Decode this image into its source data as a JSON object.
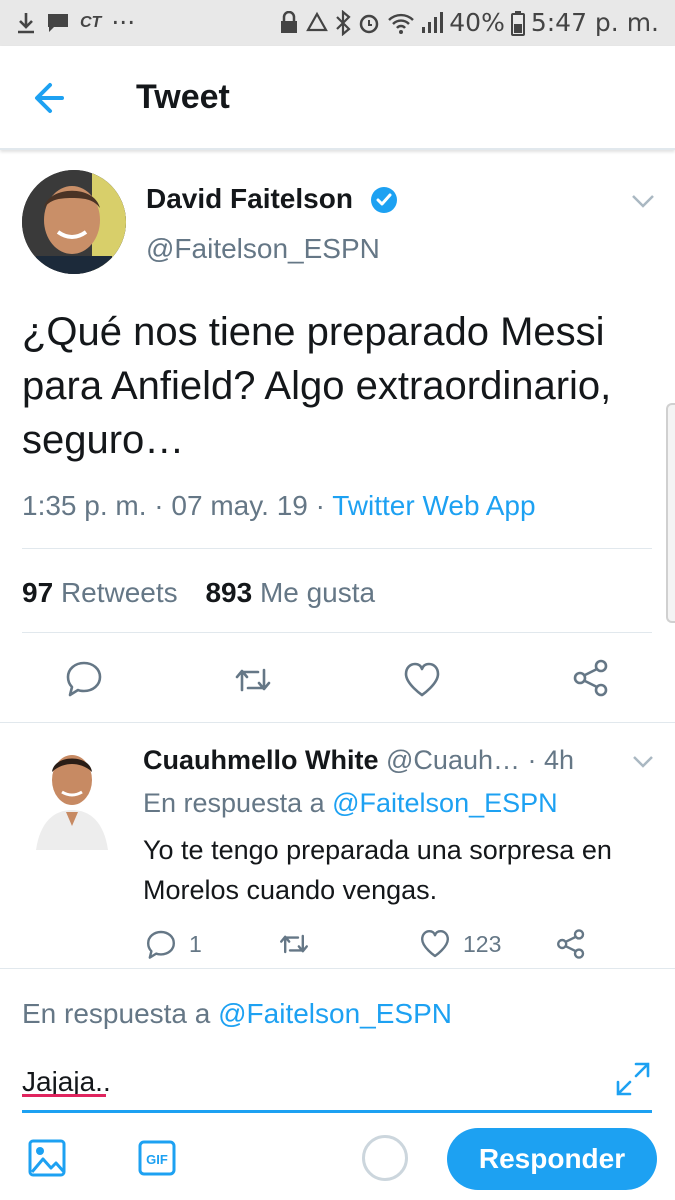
{
  "status_bar": {
    "carrier": "CT",
    "dots": "···",
    "battery": "40%",
    "time": "5:47 p. m."
  },
  "header": {
    "title": "Tweet"
  },
  "tweet": {
    "author_name": "David Faitelson",
    "author_handle": "@Faitelson_ESPN",
    "text": "¿Qué nos tiene preparado Messi para Anfield? Algo extraordinario, seguro…",
    "timestamp": "1:35 p. m. · 07 may. 19 · ",
    "source": "Twitter Web App",
    "retweets_count": "97",
    "retweets_label": "Retweets",
    "likes_count": "893",
    "likes_label": "Me gusta"
  },
  "reply": {
    "author_name": "Cuauhmello White",
    "author_handle": "@Cuauh…",
    "time": "· 4h",
    "in_reply_prefix": "En respuesta a ",
    "in_reply_mention": "@Faitelson_ESPN",
    "text": "Yo te tengo preparada una sorpresa en Morelos cuando vengas.",
    "reply_count": "1",
    "like_count": "123"
  },
  "composer": {
    "in_reply_prefix": "En respuesta a ",
    "in_reply_mention": "@Faitelson_ESPN",
    "text": "Jajaja..",
    "gif_label": "GIF",
    "submit_label": "Responder"
  },
  "colors": {
    "accent": "#1da1f2",
    "secondary_text": "#657786",
    "divider": "#e1e8ed"
  }
}
